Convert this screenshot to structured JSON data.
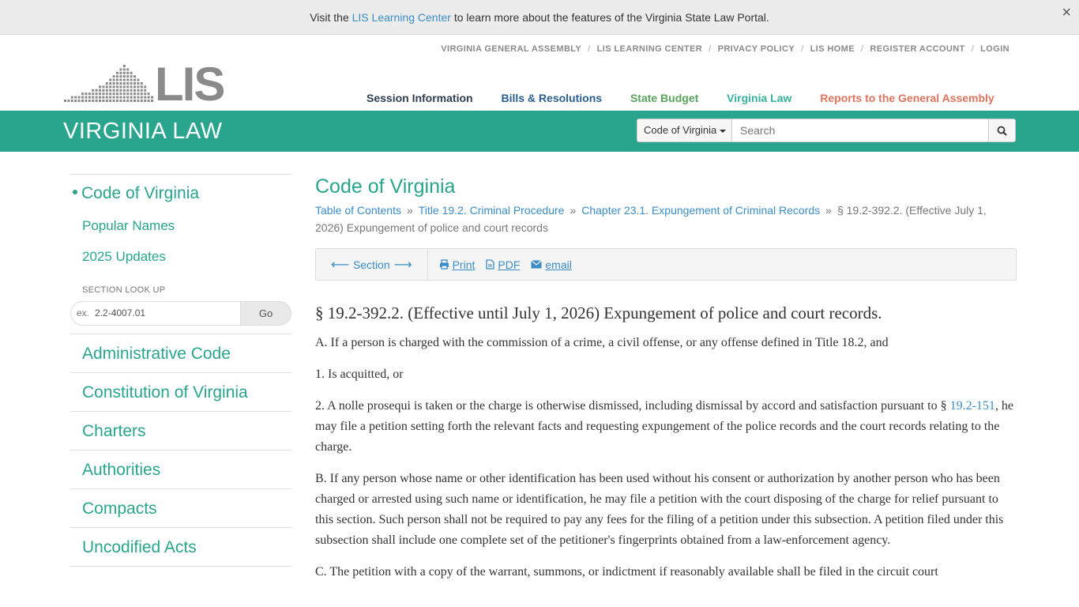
{
  "notice": {
    "text_before": "Visit the ",
    "link": "LIS Learning Center",
    "text_after": " to learn more about the features of the Virginia State Law Portal.",
    "close": "×"
  },
  "logo": {
    "text": "LIS"
  },
  "util_links": [
    "VIRGINIA GENERAL ASSEMBLY",
    "LIS LEARNING CENTER",
    "PRIVACY POLICY",
    "LIS HOME",
    "REGISTER ACCOUNT",
    "LOGIN"
  ],
  "main_nav": {
    "session": "Session Information",
    "bills": "Bills & Resolutions",
    "budget": "State Budget",
    "law": "Virginia Law",
    "reports": "Reports to the General Assembly"
  },
  "band": {
    "title": "VIRGINIA LAW",
    "search_scope": "Code of Virginia",
    "search_placeholder": "Search"
  },
  "sidebar": {
    "current": "Code of Virginia",
    "subitems": [
      "Popular Names",
      "2025 Updates"
    ],
    "lookup_label": "SECTION LOOK UP",
    "lookup_prefix": "ex.",
    "lookup_example": "2.2-4007.01",
    "lookup_button": "Go",
    "items": [
      "Administrative Code",
      "Constitution of Virginia",
      "Charters",
      "Authorities",
      "Compacts",
      "Uncodified Acts"
    ]
  },
  "content": {
    "heading": "Code of Virginia",
    "breadcrumbs": [
      "Table of Contents",
      "Title 19.2. Criminal Procedure",
      "Chapter 23.1. Expungement of Criminal Records"
    ],
    "breadcrumb_current": "§ 19.2-392.2. (Effective July 1, 2026) Expungement of police and court records",
    "toolbar": {
      "section": "Section",
      "print": "Print",
      "pdf": "PDF",
      "email": "email"
    },
    "law_title": "§ 19.2-392.2. (Effective until July 1, 2026) Expungement of police and court records.",
    "para_a": "A. If a person is charged with the commission of a crime, a civil offense, or any offense defined in Title 18.2, and",
    "para_1": "1. Is acquitted, or",
    "para_2_before": "2. A nolle prosequi is taken or the charge is otherwise dismissed, including dismissal by accord and satisfaction pursuant to § ",
    "para_2_link": "19.2-151",
    "para_2_after": ", he may file a petition setting forth the relevant facts and requesting expungement of the police records and the court records relating to the charge.",
    "para_b": "B. If any person whose name or other identification has been used without his consent or authorization by another person who has been charged or arrested using such name or identification, he may file a petition with the court disposing of the charge for relief pursuant to this section. Such person shall not be required to pay any fees for the filing of a petition under this subsection. A petition filed under this subsection shall include one complete set of the petitioner's fingerprints obtained from a law-enforcement agency.",
    "para_c": "C. The petition with a copy of the warrant, summons, or indictment if reasonably available shall be filed in the circuit court"
  }
}
